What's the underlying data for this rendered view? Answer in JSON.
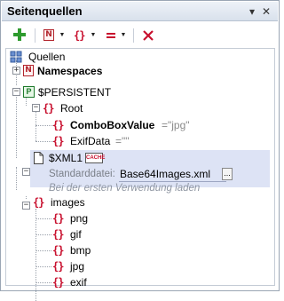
{
  "panel": {
    "title": "Seitenquellen"
  },
  "tree": {
    "root_label": "Quellen",
    "namespaces_label": "Namespaces",
    "persistent_label": "$PERSISTENT",
    "root_node_label": "Root",
    "combobox_label": "ComboBoxValue",
    "combobox_value": "=\"jpg\"",
    "exifdata_label": "ExifData",
    "exifdata_value": "=\"\"",
    "xml1_label": "$XML1",
    "cache_badge": "CACHE",
    "default_file_label": "Standarddatei:",
    "default_file_value": "Base64Images.xml",
    "browse_label": "...",
    "load_hint": "Bei der ersten Verwendung laden",
    "images_label": "images",
    "children": [
      "png",
      "gif",
      "bmp",
      "jpg",
      "exif"
    ]
  },
  "colors": {
    "add": "#2e9b2e",
    "delete": "#c8102e",
    "brace": "#c8102e",
    "selection": "#dde3f5"
  }
}
